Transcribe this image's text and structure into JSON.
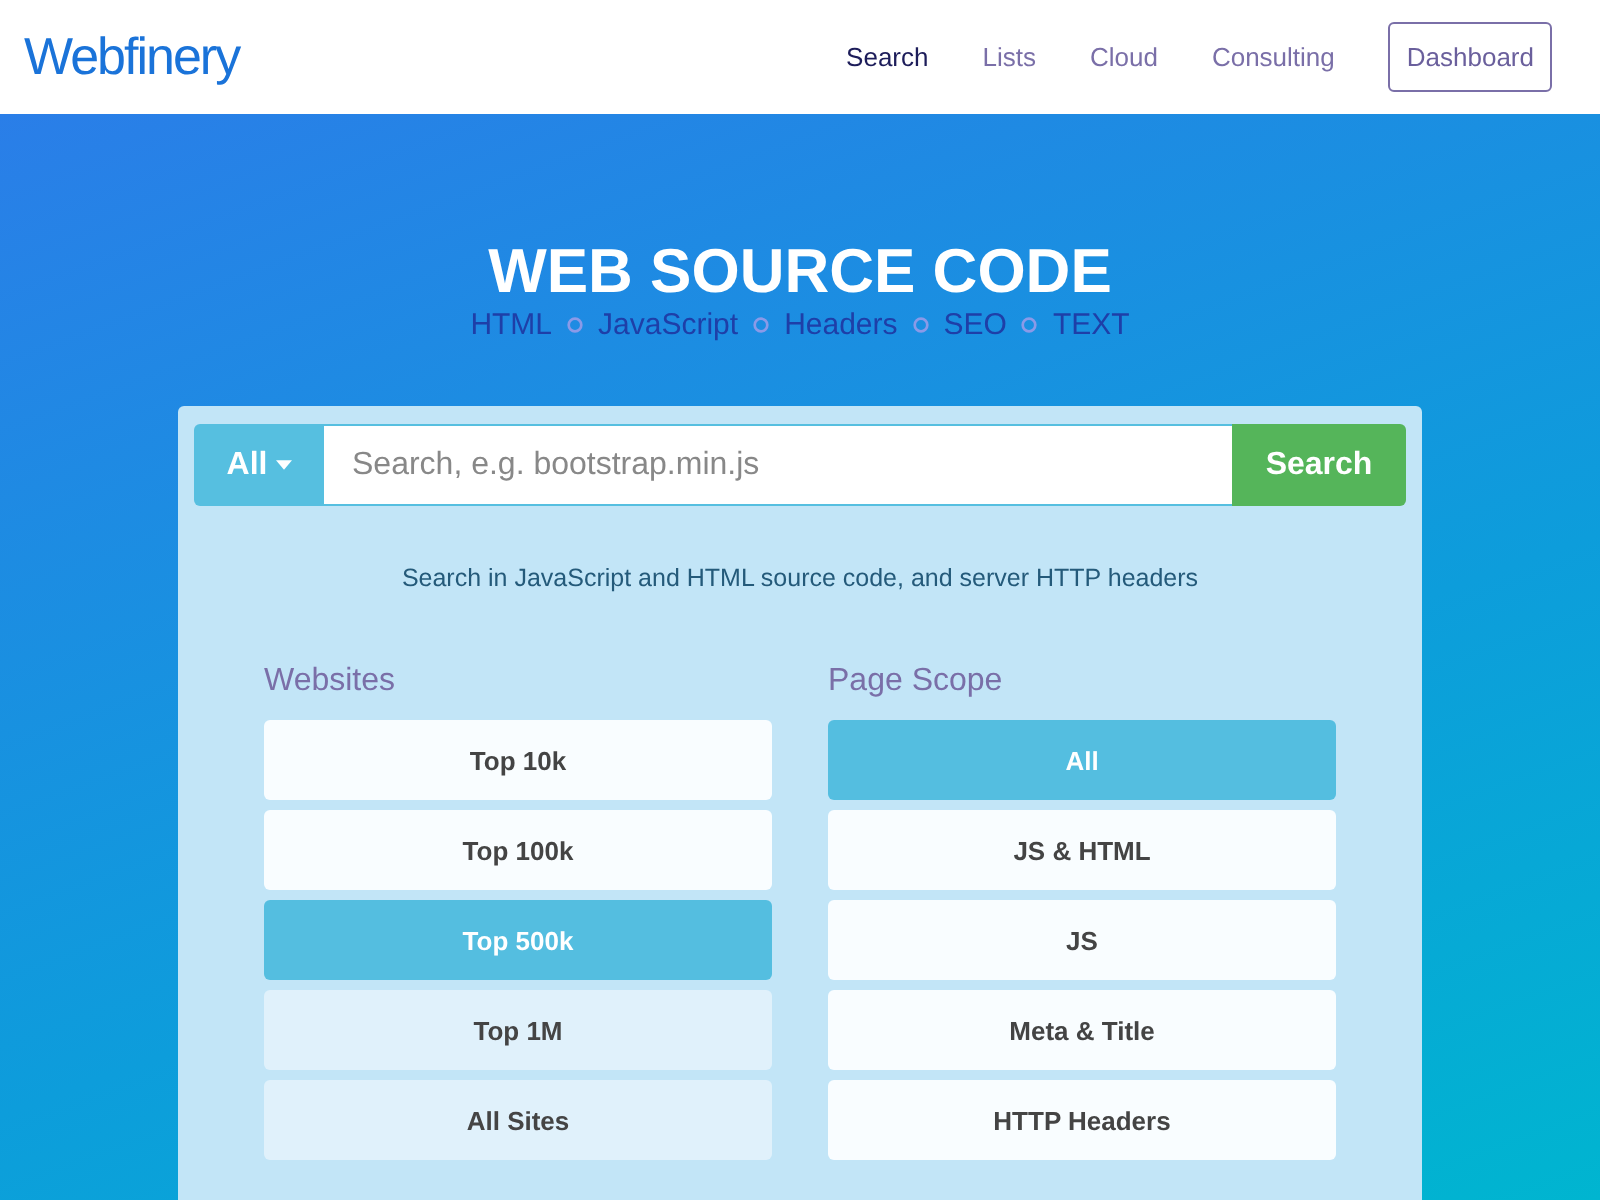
{
  "header": {
    "logo": "Webfinery",
    "nav": [
      {
        "label": "Search",
        "selected": true
      },
      {
        "label": "Lists",
        "selected": false
      },
      {
        "label": "Cloud",
        "selected": false
      },
      {
        "label": "Consulting",
        "selected": false
      }
    ],
    "dashboard_button": "Dashboard"
  },
  "hero": {
    "title": "WEB SOURCE CODE",
    "topics": [
      "HTML",
      "JavaScript",
      "Headers",
      "SEO",
      "TEXT"
    ]
  },
  "search": {
    "scope_button": "All",
    "placeholder": "Search, e.g. bootstrap.min.js",
    "submit": "Search",
    "hint": "Search in JavaScript and HTML source code, and server HTTP headers"
  },
  "websites": {
    "heading": "Websites",
    "options": [
      {
        "label": "Top 10k",
        "selected": false,
        "disabled": false
      },
      {
        "label": "Top 100k",
        "selected": false,
        "disabled": false
      },
      {
        "label": "Top 500k",
        "selected": true,
        "disabled": false
      },
      {
        "label": "Top 1M",
        "selected": false,
        "disabled": true
      },
      {
        "label": "All Sites",
        "selected": false,
        "disabled": true
      }
    ]
  },
  "page_scope": {
    "heading": "Page Scope",
    "options": [
      {
        "label": "All",
        "selected": true,
        "disabled": false
      },
      {
        "label": "JS & HTML",
        "selected": false,
        "disabled": false
      },
      {
        "label": "JS",
        "selected": false,
        "disabled": false
      },
      {
        "label": "Meta & Title",
        "selected": false,
        "disabled": false
      },
      {
        "label": "HTTP Headers",
        "selected": false,
        "disabled": false
      }
    ]
  }
}
